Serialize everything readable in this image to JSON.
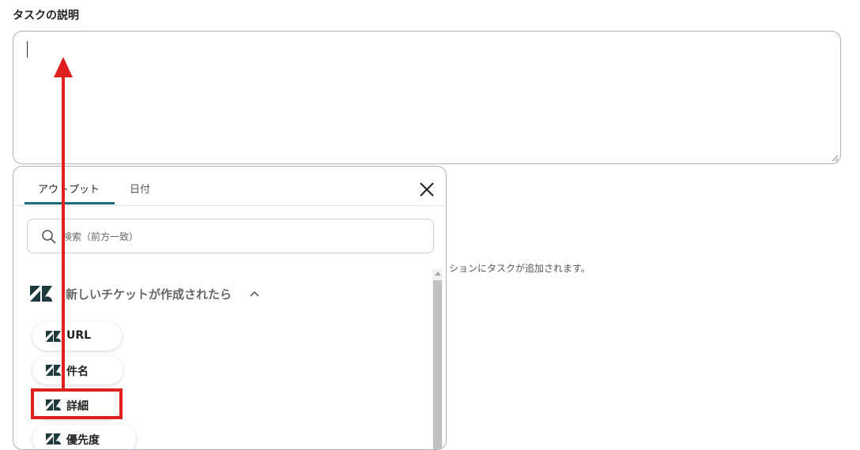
{
  "field": {
    "label": "タスクの説明"
  },
  "background_hint": "ションにタスクが追加されます。",
  "popup": {
    "tabs": [
      {
        "label": "アウトプット",
        "active": true
      },
      {
        "label": "日付",
        "active": false
      }
    ],
    "search": {
      "placeholder": "検索（前方一致）",
      "value": ""
    },
    "group": {
      "title": "新しいチケットが作成されたら",
      "expanded": true,
      "icon": "zendesk-logo-icon"
    },
    "items": [
      {
        "label": "URL"
      },
      {
        "label": "件名"
      },
      {
        "label": "詳細",
        "highlighted": true
      },
      {
        "label": "優先度"
      }
    ]
  },
  "colors": {
    "tab_accent": "#1a6e7c",
    "annotation_red": "#e0201e",
    "zendesk_logo": "#1f3a3d"
  }
}
